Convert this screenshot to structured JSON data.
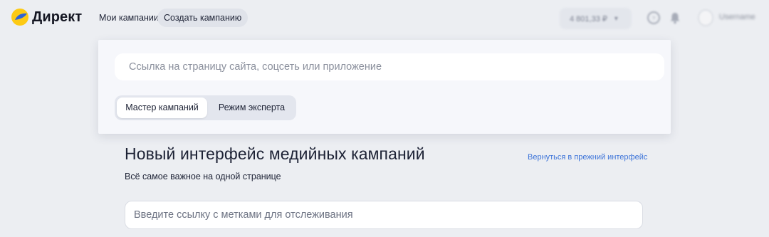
{
  "header": {
    "logo_text": "Директ",
    "nav": {
      "my_campaigns": "Мои кампании",
      "create_campaign": "Создать кампанию"
    },
    "balance": "4 801,33 ₽",
    "username": "Username"
  },
  "create_panel": {
    "site_input": {
      "placeholder": "Ссылка на страницу сайта, соцсеть или приложение",
      "value": ""
    },
    "modes": {
      "master": "Мастер кампаний",
      "expert": "Режим эксперта",
      "selected": "master"
    }
  },
  "main": {
    "title": "Новый интерфейс медийных кампаний",
    "subtitle": "Всё самое важное на одной странице",
    "back_link": "Вернуться в прежний интерфейс",
    "tracking_input": {
      "placeholder": "Введите ссылку с метками для отслеживания",
      "value": ""
    }
  },
  "icons": {
    "logo": "yandex-direct-logo-icon",
    "balance_dropdown": "chevron-down-icon",
    "help": "help-icon",
    "notifications": "bell-icon",
    "avatar": "user-avatar-icon"
  },
  "colors": {
    "background": "#eceef2",
    "panel": "#f6f7fb",
    "link": "#3d74d9",
    "logo_yellow": "#fdca14",
    "logo_blue": "#2f63d6"
  }
}
